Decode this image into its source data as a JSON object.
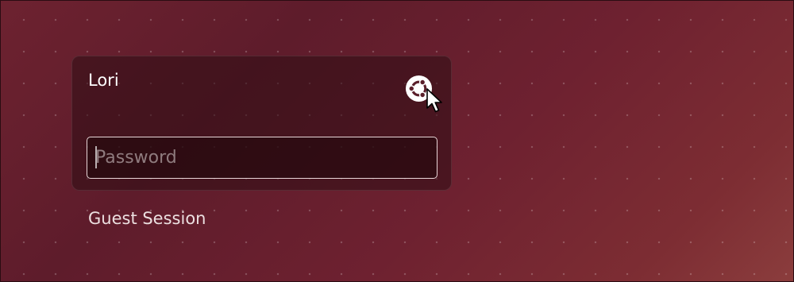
{
  "user": {
    "name": "Lori",
    "session_icon": "ubuntu-session-icon"
  },
  "password": {
    "placeholder": "Password",
    "value": ""
  },
  "guest": {
    "label": "Guest Session"
  },
  "colors": {
    "background": "#6d2230",
    "card": "#3a1019",
    "input_border": "#e8d6d8",
    "text": "#ffffff"
  }
}
